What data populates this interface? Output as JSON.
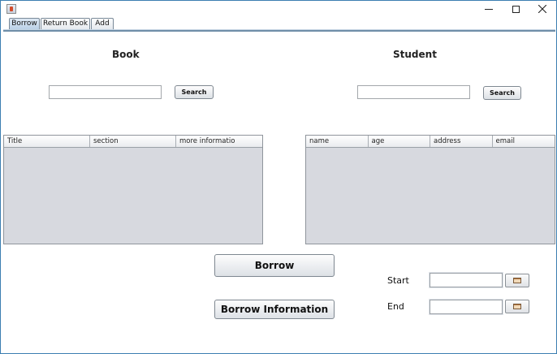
{
  "window": {
    "controls": {
      "minimize": "minimize-icon",
      "maximize": "maximize-icon",
      "close": "close-icon"
    }
  },
  "tabs": [
    {
      "label": "Borrow",
      "active": true
    },
    {
      "label": "Return Book",
      "active": false
    },
    {
      "label": "Add",
      "active": false
    }
  ],
  "book": {
    "heading": "Book",
    "search_value": "",
    "search_label": "Search",
    "columns": [
      "Title",
      "section",
      "more informatio"
    ]
  },
  "student": {
    "heading": "Student",
    "search_value": "",
    "search_label": "Search",
    "columns": [
      "name",
      "age",
      "address",
      "email"
    ]
  },
  "actions": {
    "borrow_label": "Borrow",
    "borrow_info_label": "Borrow Information"
  },
  "dates": {
    "start_label": "Start",
    "start_value": "",
    "end_label": "End",
    "end_value": "",
    "picker_icon": "calendar-icon"
  },
  "colors": {
    "table_bg": "#d7d9df",
    "active_tab": "#b8cfe6",
    "window_border": "#3c7fb1"
  }
}
